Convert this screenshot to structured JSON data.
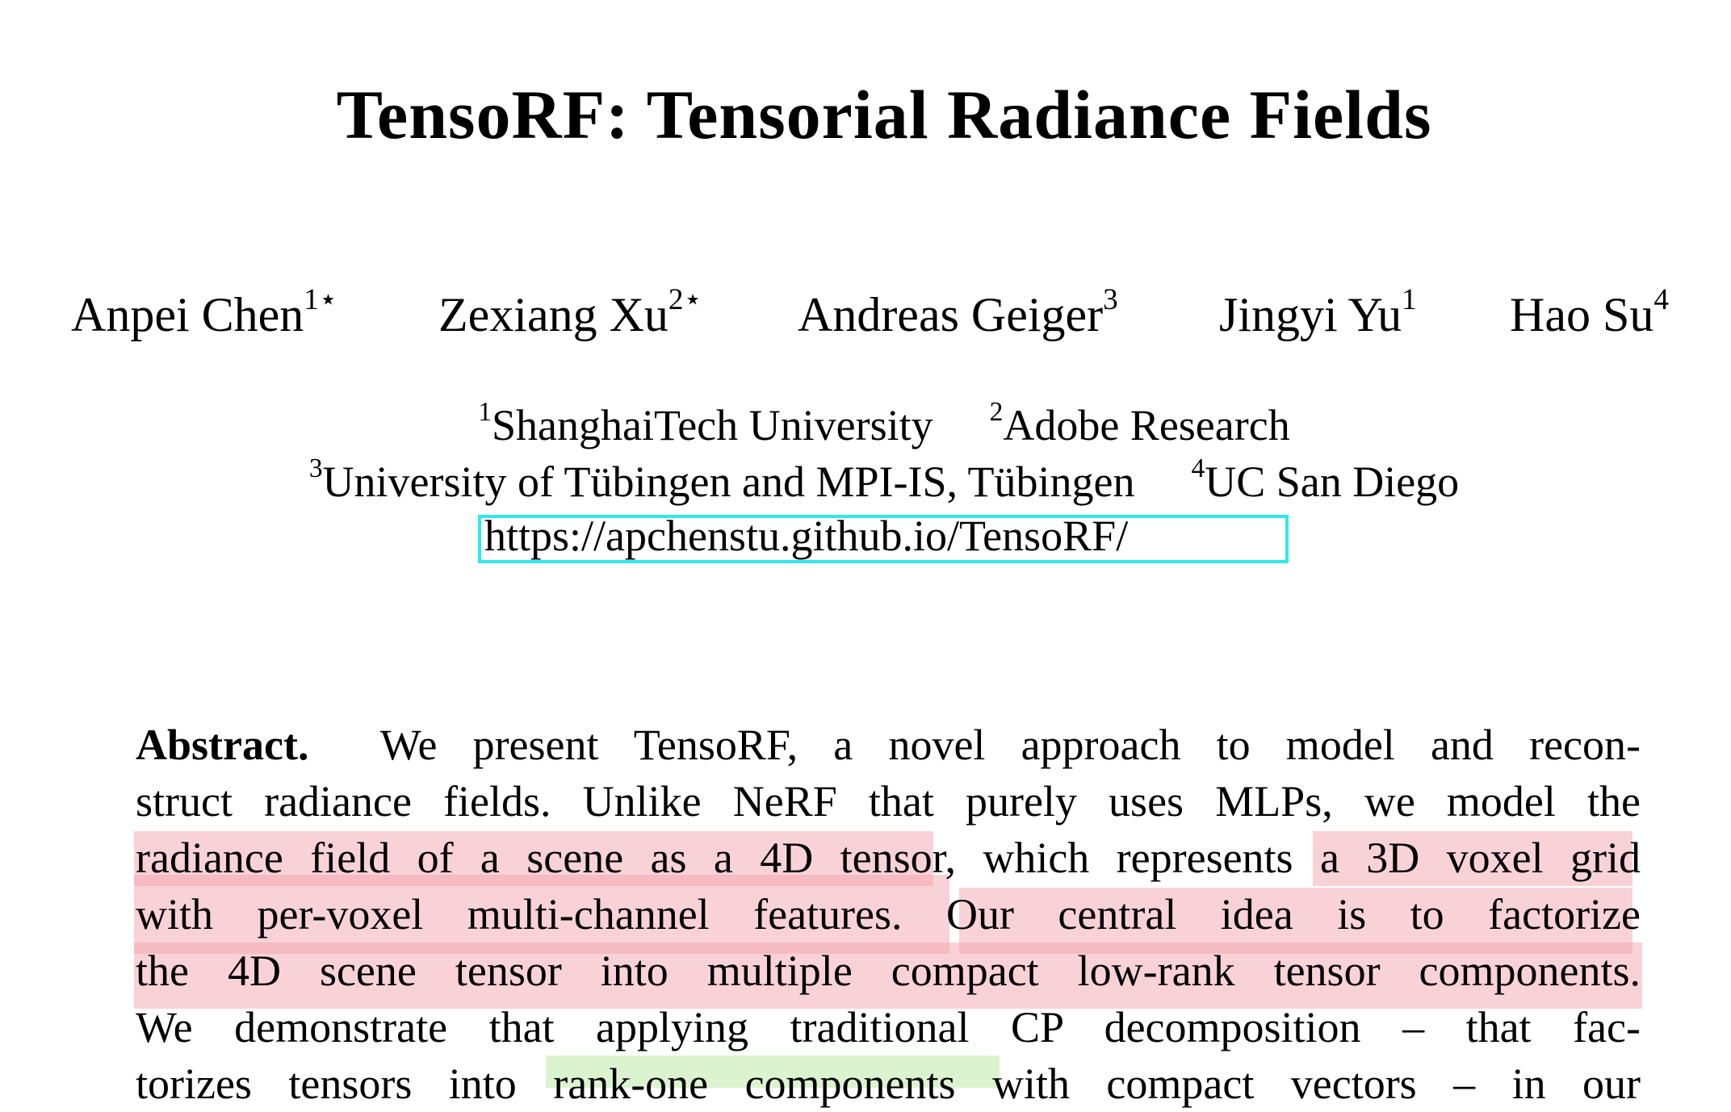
{
  "paper": {
    "title": "TensoRF: Tensorial Radiance Fields",
    "authors": [
      {
        "name": "Anpei Chen",
        "sup": "1⋆"
      },
      {
        "name": "Zexiang Xu",
        "sup": "2⋆"
      },
      {
        "name": "Andreas Geiger",
        "sup": "3"
      },
      {
        "name": "Jingyi Yu",
        "sup": "1"
      },
      {
        "name": "Hao Su",
        "sup": "4"
      }
    ],
    "affiliations": [
      {
        "sup": "1",
        "name": "ShanghaiTech University"
      },
      {
        "sup": "2",
        "name": "Adobe Research"
      },
      {
        "sup": "3",
        "name": "University of Tübingen and MPI-IS, Tübingen"
      },
      {
        "sup": "4",
        "name": "UC San Diego"
      }
    ],
    "project_url": "https://apchenstu.github.io/TensoRF/",
    "link_box_color": "#2ee8ee",
    "abstract": {
      "label": "Abstract.",
      "lines": [
        "We present TensoRF, a novel approach to model and recon-",
        "struct radiance fields. Unlike NeRF that purely uses MLPs, we model the",
        "radiance field of a scene as a 4D tensor, which represents a 3D voxel grid",
        "with per-voxel multi-channel features. Our central idea is to factorize",
        "the 4D scene tensor into multiple compact low-rank tensor components.",
        "We demonstrate that applying traditional CP decomposition – that fac-",
        "torizes tensors into rank-one components with compact vectors – in our"
      ]
    },
    "highlights": {
      "pink_color": "#f7c9d0",
      "green_color": "#dcf2d0",
      "pink_phrases": [
        "radiance field of a scene as a 4D tensor",
        "a 3D voxel grid",
        "with per-voxel multi-channel features.",
        "Our central idea is to factorize",
        "the 4D scene tensor into multiple compact low-rank tensor components."
      ],
      "green_phrases": [
        "rank-one components"
      ]
    }
  }
}
